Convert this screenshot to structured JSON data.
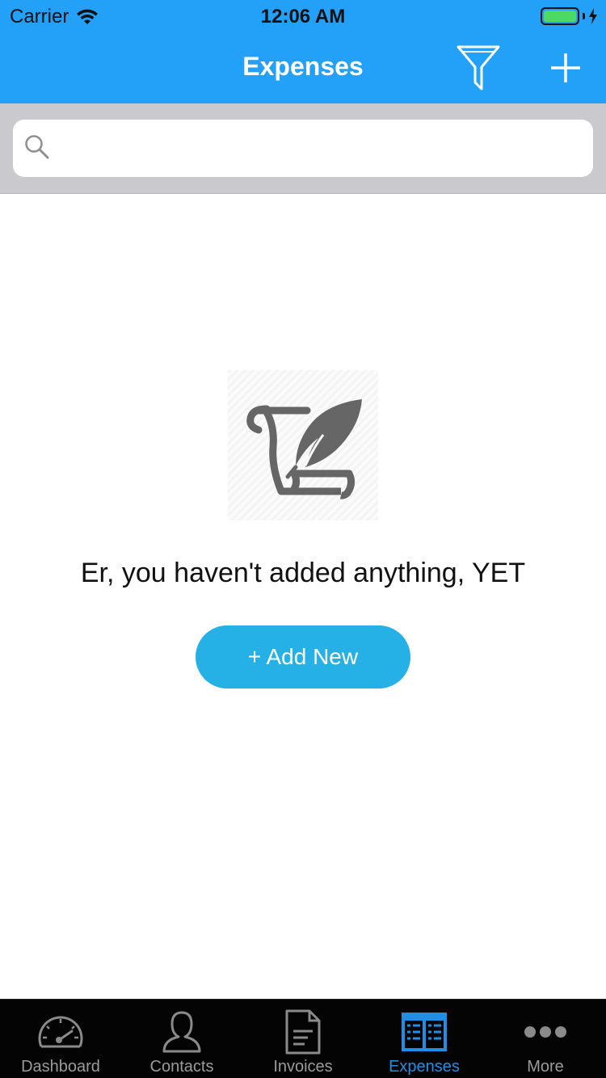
{
  "status_bar": {
    "carrier": "Carrier",
    "time": "12:06 AM",
    "battery_color": "#4cd964"
  },
  "nav": {
    "title": "Expenses",
    "filter_icon": "filter-funnel-icon",
    "add_icon": "plus-icon",
    "background": "#23a0f7"
  },
  "search": {
    "placeholder": "",
    "value": ""
  },
  "empty_state": {
    "icon": "scroll-quill-icon",
    "message": "Er, you haven't added anything, YET",
    "button_label": "+ Add New",
    "button_color": "#25b1e6"
  },
  "tabbar": {
    "active_color": "#1f8fe5",
    "items": [
      {
        "label": "Dashboard",
        "icon": "speedometer-icon",
        "active": false
      },
      {
        "label": "Contacts",
        "icon": "person-icon",
        "active": false
      },
      {
        "label": "Invoices",
        "icon": "document-icon",
        "active": false
      },
      {
        "label": "Expenses",
        "icon": "expenses-ledger-icon",
        "active": true
      },
      {
        "label": "More",
        "icon": "more-dots-icon",
        "active": false
      }
    ]
  }
}
